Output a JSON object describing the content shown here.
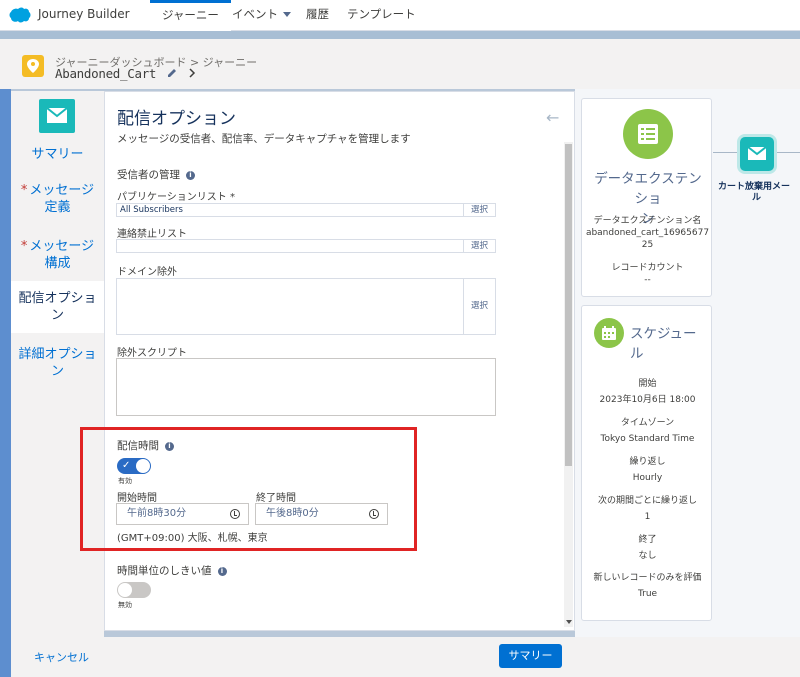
{
  "app": {
    "name": "Journey Builder"
  },
  "nav": {
    "tabs": [
      {
        "label": "ジャーニー"
      },
      {
        "label": "イベント"
      },
      {
        "label": "履歴"
      },
      {
        "label": "テンプレート"
      }
    ]
  },
  "header": {
    "breadcrumb": "ジャーニーダッシュボード > ジャーニー",
    "journey_name": "Abandoned_Cart"
  },
  "sidebar": {
    "items": [
      {
        "label": "サマリー"
      },
      {
        "label_line1": "メッセージ",
        "label_line2": "定義"
      },
      {
        "label_line1": "メッセージ",
        "label_line2": "構成"
      },
      {
        "label_line1": "配信オプショ",
        "label_line2": "ン"
      },
      {
        "label_line1": "詳細オプショ",
        "label_line2": "ン"
      }
    ]
  },
  "panel": {
    "title": "配信オプション",
    "description": "メッセージの受信者、配信率、データキャプチャを管理します",
    "recipients_heading": "受信者の管理",
    "publication_list_label": "パブリケーションリスト *",
    "publication_list_value": "All Subscribers",
    "select_label": "選択",
    "suppression_label": "連絡禁止リスト",
    "domain_exclusion_label": "ドメイン除外",
    "exclusion_script_label": "除外スクリプト",
    "send_time_label": "配信時間",
    "send_time_toggle_text": "有効",
    "start_time_label": "開始時間",
    "start_time_value": "午前8時30分",
    "end_time_label": "終了時間",
    "end_time_value": "午後8時0分",
    "timezone_text": "(GMT+09:00) 大阪、札幌、東京",
    "threshold_label": "時間単位のしきい値",
    "threshold_toggle_text": "無効"
  },
  "footer": {
    "cancel_label": "キャンセル",
    "summary_label": "サマリー"
  },
  "canvas": {
    "data_extension": {
      "title_line1": "データエクステンショ",
      "title_line2": "ン",
      "de_name_label": "データエクステンション名",
      "de_name_line1": "abandoned_cart_16965677",
      "de_name_line2": "25",
      "record_count_label": "レコードカウント",
      "record_count_value": "--"
    },
    "schedule": {
      "title_line1": "スケジュー",
      "title_line2": "ル",
      "start_label": "開始",
      "start_value": "2023年10月6日 18:00",
      "timezone_label": "タイムゾーン",
      "timezone_value": "Tokyo Standard Time",
      "repeat_label": "繰り返し",
      "repeat_value": "Hourly",
      "repeat_every_label": "次の期間ごとに繰り返し",
      "repeat_every_value": "1",
      "end_label": "終了",
      "end_value": "なし",
      "new_records_label": "新しいレコードのみを評価",
      "new_records_value": "True"
    },
    "email_node_label_line1": "カート放棄用メー",
    "email_node_label_line2": "ル"
  },
  "colors": {
    "brand_blue": "#0070d2",
    "highlight_red": "#e02424",
    "teal": "#1ab9b9",
    "green": "#8cc549",
    "toggle_on": "#2a6bc4"
  },
  "icons": [
    "salesforce-cloud-icon",
    "map-pin-icon",
    "envelope-icon",
    "list-icon",
    "calendar-icon",
    "info-icon",
    "clock-icon",
    "back-arrow-icon",
    "pencil-icon",
    "chevron-right-icon",
    "chevron-down-icon"
  ]
}
